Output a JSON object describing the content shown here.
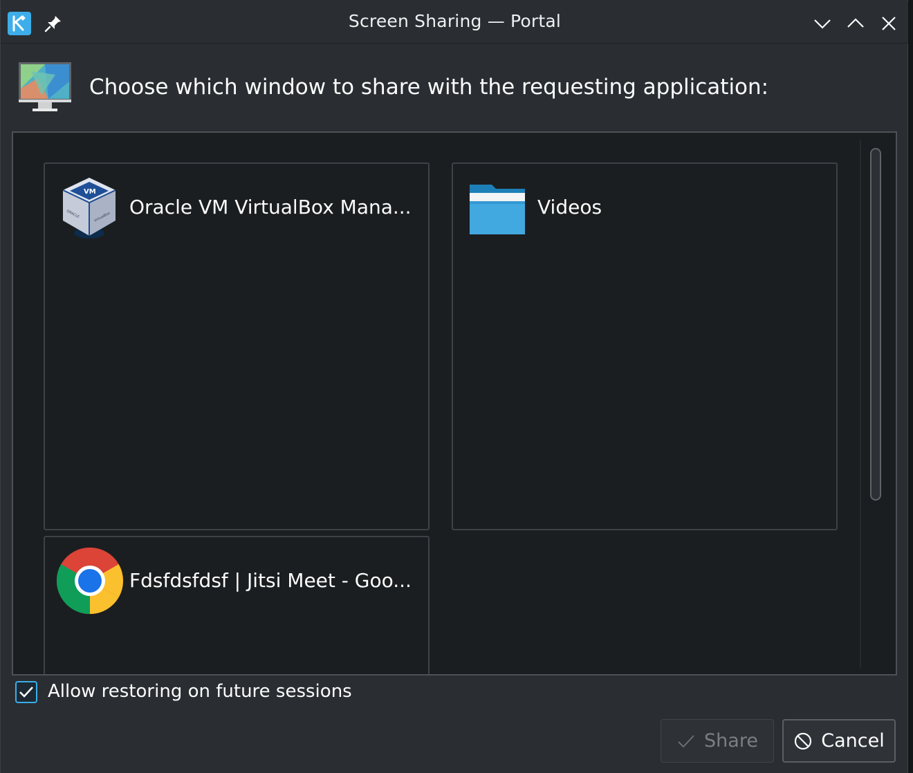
{
  "window": {
    "title": "Screen Sharing — Portal"
  },
  "titlebar_icons": {
    "app": "kde-logo-icon",
    "pin": "pin-icon",
    "minimize": "chevron-down-icon",
    "maximize": "chevron-up-icon",
    "close": "close-icon"
  },
  "header": {
    "prompt": "Choose which window to share with the requesting application:",
    "icon": "monitor-icon"
  },
  "windows": [
    {
      "label": "Oracle VM VirtualBox Mana...",
      "icon": "virtualbox-icon"
    },
    {
      "label": "Videos",
      "icon": "folder-icon"
    },
    {
      "label": "Fdsfdsfdsf | Jitsi Meet - Goo...",
      "icon": "chrome-icon"
    }
  ],
  "options": {
    "restore_label": "Allow restoring on future sessions",
    "restore_checked": true
  },
  "buttons": {
    "share_label": "Share",
    "cancel_label": "Cancel"
  },
  "colors": {
    "accent": "#3daee9",
    "background": "#2a2e32",
    "list_background": "#1b1e20"
  }
}
